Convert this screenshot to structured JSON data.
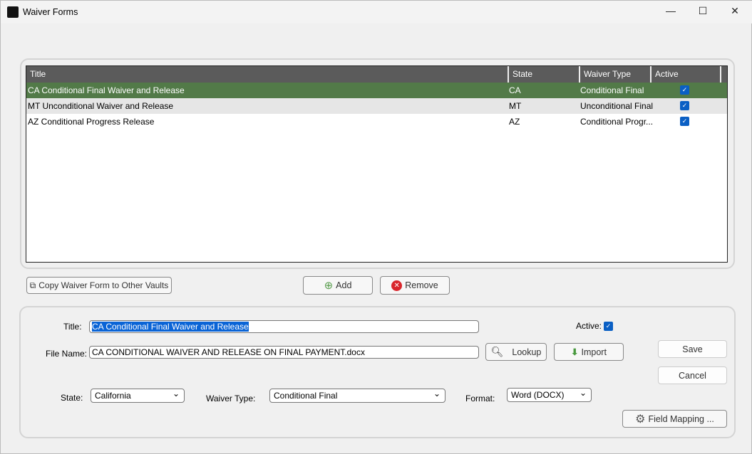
{
  "window": {
    "title": "Waiver Forms",
    "minimize": "—",
    "maximize": "☐",
    "close": "✕"
  },
  "grid": {
    "columns": [
      "Title",
      "State",
      "Waiver Type",
      "Active"
    ],
    "rows": [
      {
        "title": "CA Conditional Final Waiver and Release",
        "state": "CA",
        "type": "Conditional Final",
        "active": true
      },
      {
        "title": "MT Unconditional Waiver and Release",
        "state": "MT",
        "type": "Unconditional Final",
        "active": true
      },
      {
        "title": "AZ Conditional Progress Release",
        "state": "AZ",
        "type": "Conditional Progr...",
        "active": true
      }
    ],
    "selected_color": "#527a48"
  },
  "actions": {
    "copy": "Copy Waiver Form to Other Vaults",
    "add": "Add",
    "remove": "Remove"
  },
  "form": {
    "title_label": "Title:",
    "title_value": "CA Conditional Final Waiver and Release",
    "active_label": "Active:",
    "active": true,
    "file_label": "File Name:",
    "file_value": "CA CONDITIONAL WAIVER AND RELEASE ON FINAL PAYMENT.docx",
    "lookup": "Lookup",
    "import": "Import",
    "save": "Save",
    "cancel": "Cancel",
    "state_label": "State:",
    "state_value": "California",
    "type_label": "Waiver Type:",
    "type_value": "Conditional Final",
    "format_label": "Format:",
    "format_value": "Word (DOCX)",
    "field_mapping": "Field Mapping ..."
  }
}
